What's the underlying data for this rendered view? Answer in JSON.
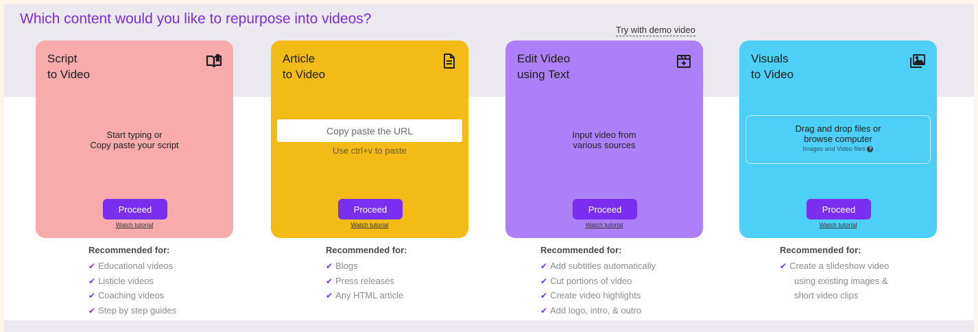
{
  "heading": "Which content would you like to repurpose into videos?",
  "demo_link": "Try with demo video",
  "cards": [
    {
      "title_line1": "Script",
      "title_line2": "to Video",
      "icon": "book-icon",
      "body_line1": "Start typing or",
      "body_line2": "Copy paste your script",
      "proceed": "Proceed",
      "tutorial": "Watch tutorial",
      "color": "#f7abab"
    },
    {
      "title_line1": "Article",
      "title_line2": "to Video",
      "icon": "document-icon",
      "url_placeholder": "Copy paste the URL",
      "paste_hint": "Use ctrl+v to paste",
      "proceed": "Proceed",
      "tutorial": "Watch tutorial",
      "color": "#f2bb16"
    },
    {
      "title_line1": "Edit Video",
      "title_line2": "using Text",
      "icon": "video-edit-icon",
      "body_line1": "Input video from",
      "body_line2": "various sources",
      "proceed": "Proceed",
      "tutorial": "Watch tutorial",
      "color": "#ad7ff9"
    },
    {
      "title_line1": "Visuals",
      "title_line2": "to Video",
      "icon": "images-icon",
      "drop_line1": "Drag and drop files or",
      "drop_line2": "browse computer",
      "drop_sub": "Images and Video files",
      "proceed": "Proceed",
      "tutorial": "Watch tutorial",
      "color": "#4dcff8"
    }
  ],
  "recommended": [
    {
      "heading": "Recommended for:",
      "items": [
        "Educational videos",
        "Listicle videos",
        "Coaching videos",
        "Step by step guides"
      ]
    },
    {
      "heading": "Recommended for:",
      "items": [
        "Blogs",
        "Press releases",
        "Any HTML article"
      ]
    },
    {
      "heading": "Recommended for:",
      "items": [
        "Add subtitles automatically",
        "Cut portions of video",
        "Create video highlights",
        "Add logo, intro, & outro"
      ]
    },
    {
      "heading": "Recommended for:",
      "items_wrapped": [
        "Create a slideshow video",
        "using existing images &",
        "short video clips"
      ]
    }
  ],
  "colors": {
    "accent": "#7a2ff0",
    "heading": "#7a2fd6"
  }
}
